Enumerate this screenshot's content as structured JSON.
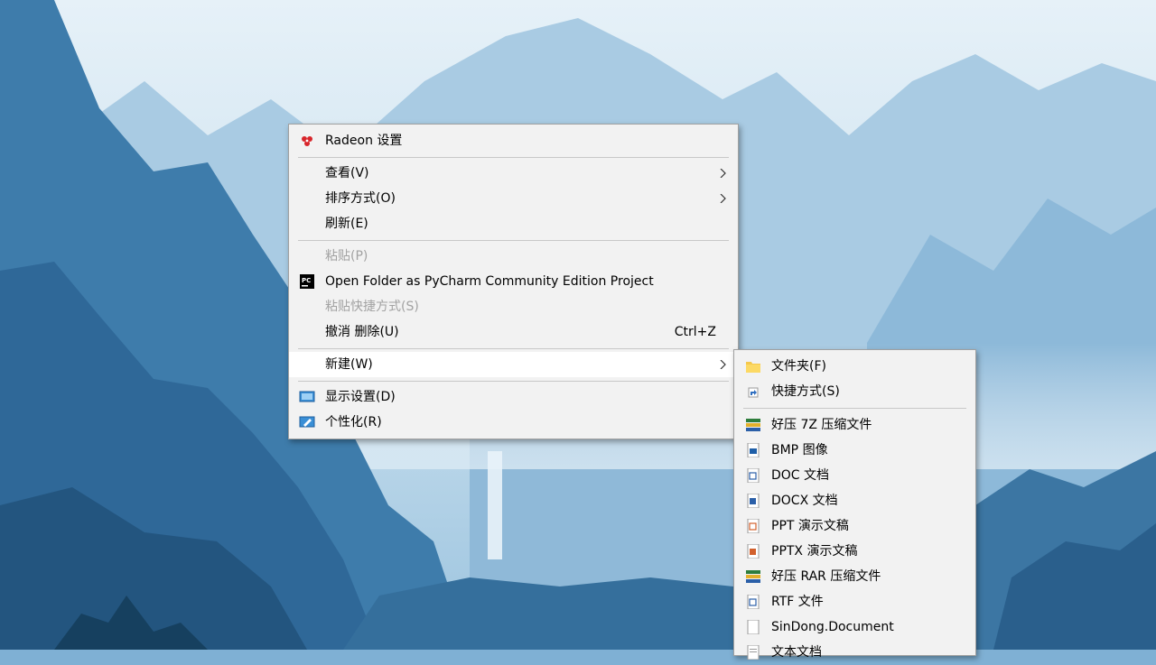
{
  "context_menu": {
    "items": [
      {
        "label": "Radeon 设置",
        "icon": "radeon-icon"
      },
      {
        "label": "查看(V)",
        "submenu": true
      },
      {
        "label": "排序方式(O)",
        "submenu": true
      },
      {
        "label": "刷新(E)"
      },
      {
        "label": "粘贴(P)",
        "disabled": true
      },
      {
        "label": "Open Folder as PyCharm Community Edition Project",
        "icon": "pycharm-icon"
      },
      {
        "label": "粘贴快捷方式(S)",
        "disabled": true
      },
      {
        "label": "撤消 删除(U)",
        "shortcut": "Ctrl+Z"
      },
      {
        "label": "新建(W)",
        "submenu": true
      },
      {
        "label": "显示设置(D)",
        "icon": "display-icon"
      },
      {
        "label": "个性化(R)",
        "icon": "personalize-icon"
      }
    ]
  },
  "new_submenu": {
    "items": [
      {
        "label": "文件夹(F)",
        "icon": "folder-icon"
      },
      {
        "label": "快捷方式(S)",
        "icon": "shortcut-icon"
      },
      {
        "label": "好压 7Z 压缩文件",
        "icon": "archive-icon"
      },
      {
        "label": "BMP 图像",
        "icon": "bmp-icon"
      },
      {
        "label": "DOC 文档",
        "icon": "doc-icon"
      },
      {
        "label": "DOCX 文档",
        "icon": "docx-icon"
      },
      {
        "label": "PPT 演示文稿",
        "icon": "ppt-icon"
      },
      {
        "label": "PPTX 演示文稿",
        "icon": "pptx-icon"
      },
      {
        "label": "好压 RAR 压缩文件",
        "icon": "archive-icon"
      },
      {
        "label": "RTF 文件",
        "icon": "rtf-icon"
      },
      {
        "label": "SinDong.Document",
        "icon": "blank-document-icon"
      },
      {
        "label": "文本文档",
        "icon": "text-document-icon"
      }
    ]
  },
  "colors": {
    "menu_bg": "#f2f2f2",
    "hover_bg": "#ffffff",
    "disabled_text": "#a2a2a2",
    "accent_blue": "#3a6fb8"
  }
}
